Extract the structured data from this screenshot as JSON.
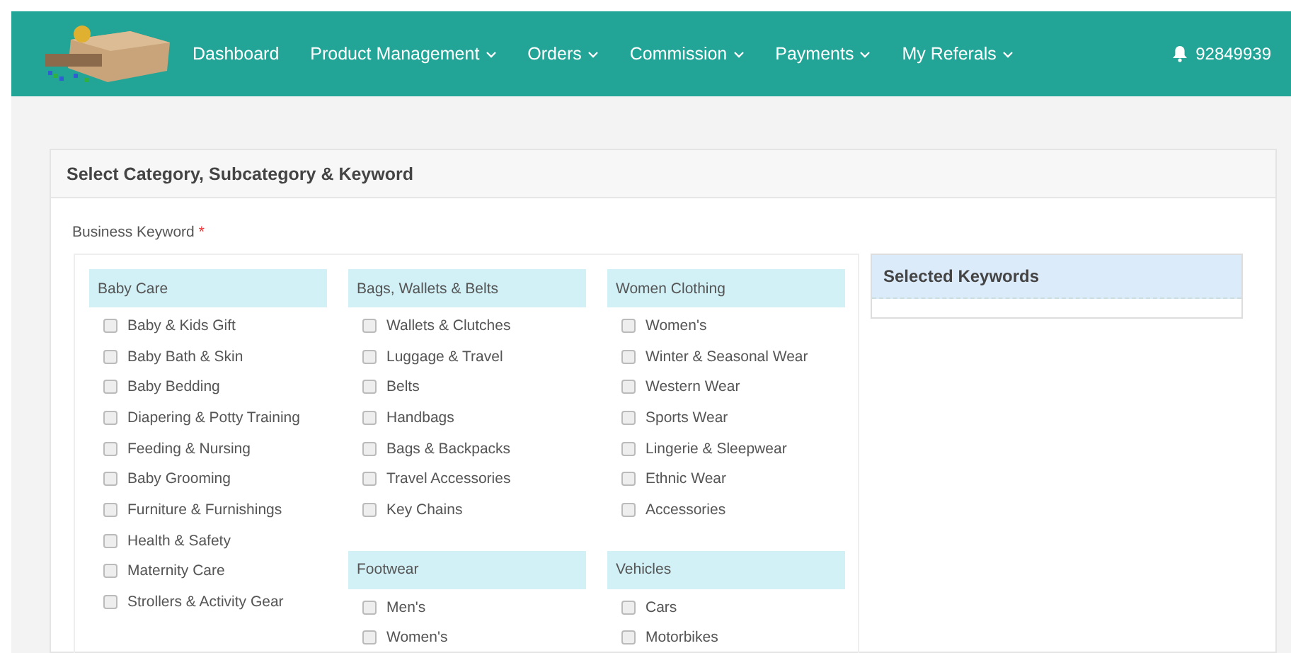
{
  "header": {
    "nav": [
      {
        "label": "Dashboard",
        "dropdown": false
      },
      {
        "label": "Product Management",
        "dropdown": true
      },
      {
        "label": "Orders",
        "dropdown": true
      },
      {
        "label": "Commission",
        "dropdown": true
      },
      {
        "label": "Payments",
        "dropdown": true
      },
      {
        "label": "My Referals",
        "dropdown": true
      }
    ],
    "user_id": "92849939"
  },
  "panel": {
    "title": "Select Category, Subcategory & Keyword",
    "field_label": "Business Keyword",
    "required_mark": "*",
    "columns": [
      {
        "groups": [
          {
            "title": "Baby Care",
            "items": [
              {
                "label": "Baby & Kids Gift",
                "checked": false
              },
              {
                "label": "Baby Bath & Skin",
                "checked": false
              },
              {
                "label": "Baby Bedding",
                "checked": false
              },
              {
                "label": "Diapering & Potty Training",
                "checked": false
              },
              {
                "label": "Feeding & Nursing",
                "checked": false
              },
              {
                "label": "Baby Grooming",
                "checked": false
              },
              {
                "label": "Furniture & Furnishings",
                "checked": false
              },
              {
                "label": "Health & Safety",
                "checked": false
              },
              {
                "label": "Maternity Care",
                "checked": false
              },
              {
                "label": "Strollers & Activity Gear",
                "checked": false
              }
            ]
          }
        ]
      },
      {
        "groups": [
          {
            "title": "Bags, Wallets & Belts",
            "items": [
              {
                "label": "Wallets & Clutches",
                "checked": false
              },
              {
                "label": "Luggage & Travel",
                "checked": false
              },
              {
                "label": "Belts",
                "checked": false
              },
              {
                "label": "Handbags",
                "checked": false
              },
              {
                "label": "Bags & Backpacks",
                "checked": false
              },
              {
                "label": "Travel Accessories",
                "checked": false
              },
              {
                "label": "Key Chains",
                "checked": false
              }
            ]
          },
          {
            "title": "Footwear",
            "items": [
              {
                "label": "Men's",
                "checked": false
              },
              {
                "label": "Women's",
                "checked": false
              }
            ]
          }
        ]
      },
      {
        "groups": [
          {
            "title": "Women Clothing",
            "items": [
              {
                "label": "Women's",
                "checked": false
              },
              {
                "label": "Winter & Seasonal Wear",
                "checked": false
              },
              {
                "label": "Western Wear",
                "checked": false
              },
              {
                "label": "Sports Wear",
                "checked": false
              },
              {
                "label": "Lingerie & Sleepwear",
                "checked": false
              },
              {
                "label": "Ethnic Wear",
                "checked": false
              },
              {
                "label": "Accessories",
                "checked": false
              }
            ]
          },
          {
            "title": "Vehicles",
            "items": [
              {
                "label": "Cars",
                "checked": false
              },
              {
                "label": "Motorbikes",
                "checked": false
              }
            ]
          }
        ]
      }
    ],
    "selected_title": "Selected Keywords"
  }
}
